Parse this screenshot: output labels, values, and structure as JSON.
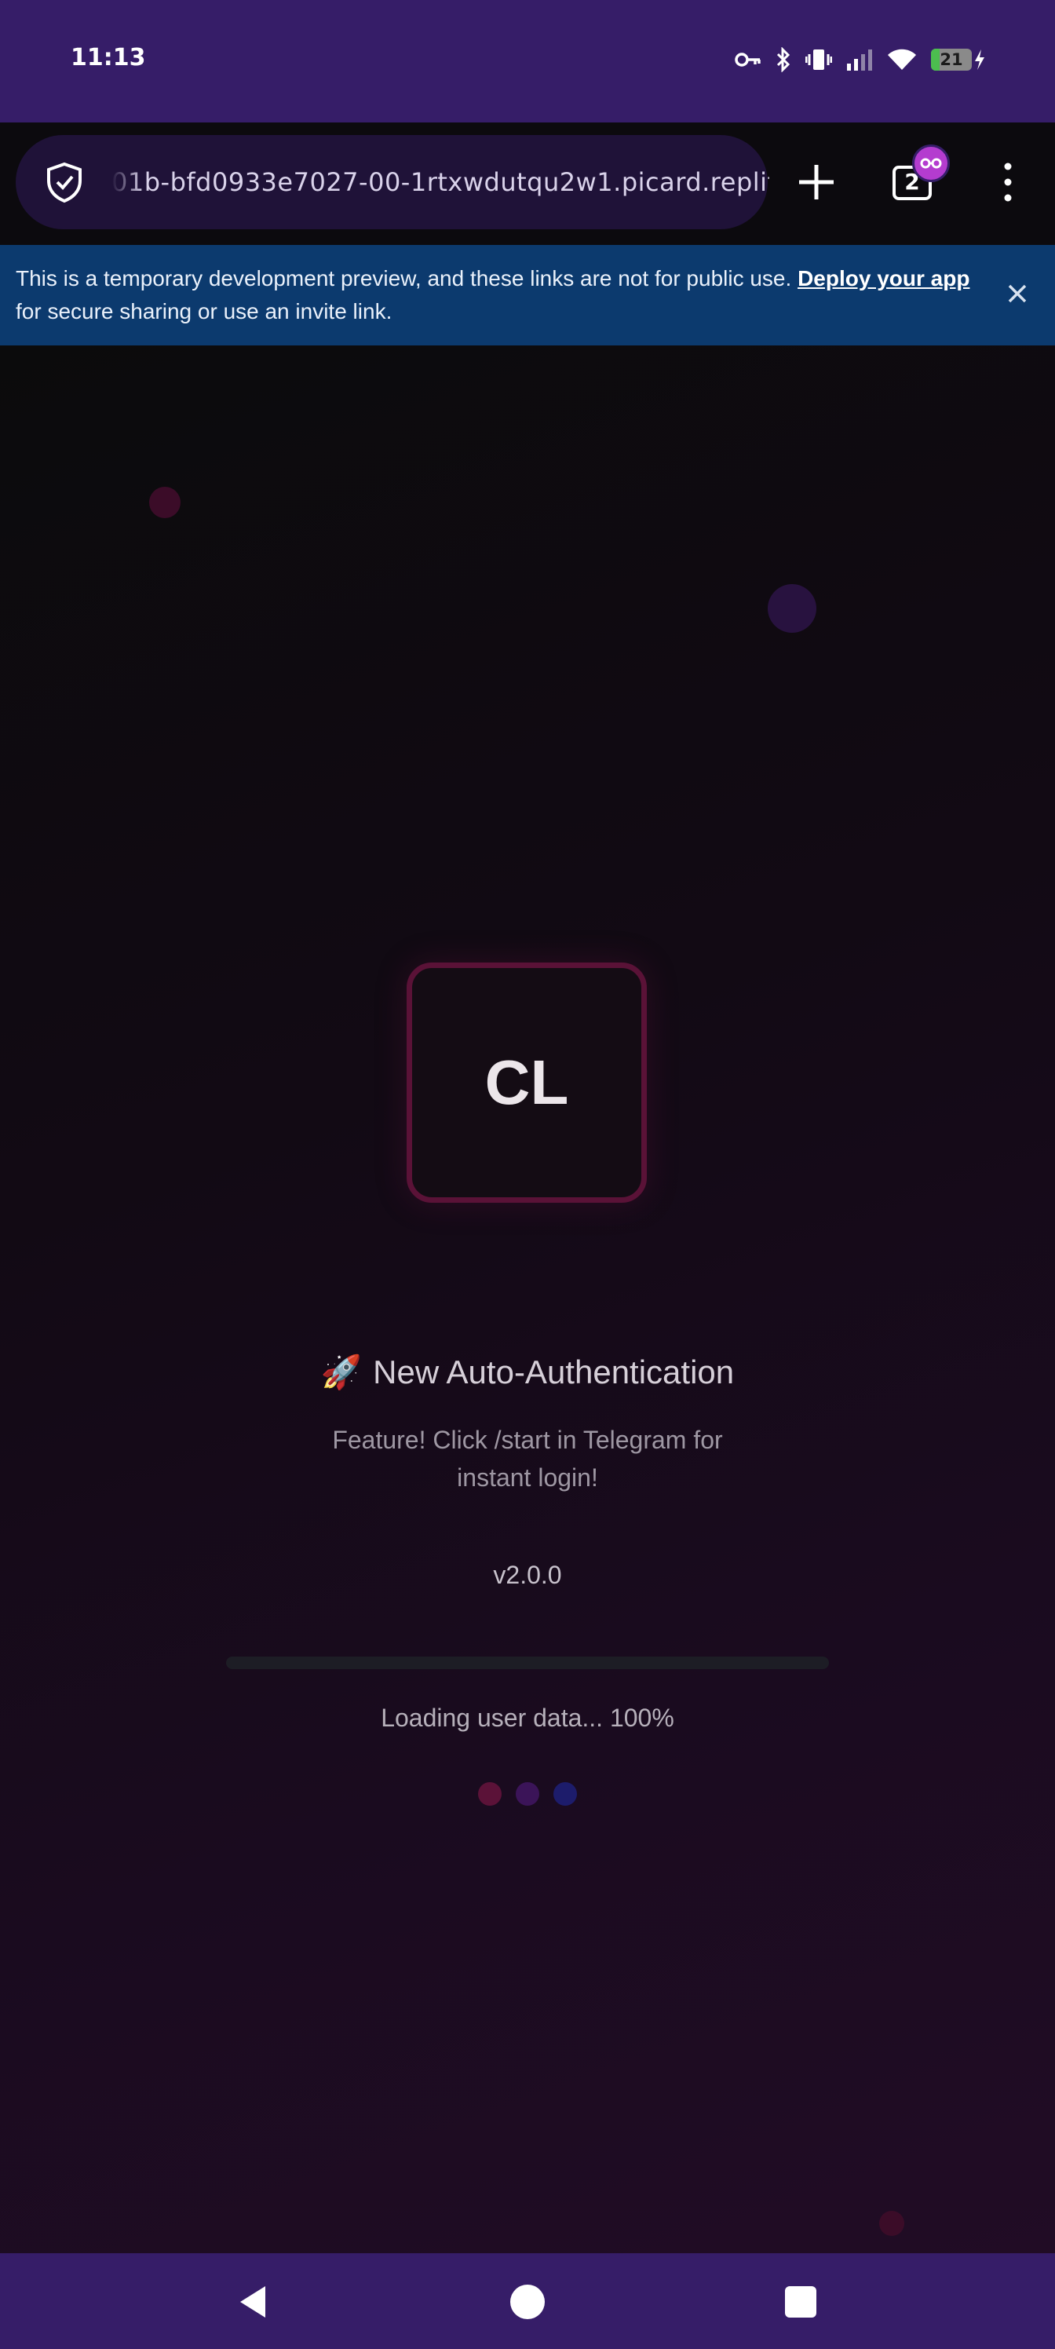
{
  "status_bar": {
    "time": "11:13",
    "battery_level": "21",
    "battery_fraction": 0.21,
    "icons": [
      "key-icon",
      "bluetooth-icon",
      "vibrate-icon",
      "cell-signal-icon",
      "wifi-icon",
      "battery-icon",
      "charging-bolt-icon"
    ]
  },
  "browser": {
    "url": "01b-bfd0933e7027-00-1rtxwdutqu2w1.picard.replit.",
    "tab_count": "2",
    "icons": [
      "shield-check-icon",
      "plus-icon",
      "tab-switcher-icon",
      "incognito-icon",
      "more-vert-icon"
    ]
  },
  "dev_banner": {
    "text_before": "This is a temporary development preview, and these links are not for public use. ",
    "link_text": "Deploy your app",
    "text_after": " for secure sharing or use an invite link."
  },
  "app": {
    "logo_text": "CL",
    "headline_emoji": "🚀",
    "headline": "New Auto-Authentication",
    "subline": "Feature! Click /start in Telegram for instant login!",
    "version": "v2.0.0",
    "loading_text": "Loading user data... 100%",
    "progress": 1.0,
    "loader_dot_colors": [
      "#5b1238",
      "#3b1458",
      "#1d1c6b"
    ],
    "accent_color": "#5a1237"
  },
  "nav_bar": {
    "icons": [
      "back-icon",
      "home-icon",
      "recents-icon"
    ]
  }
}
